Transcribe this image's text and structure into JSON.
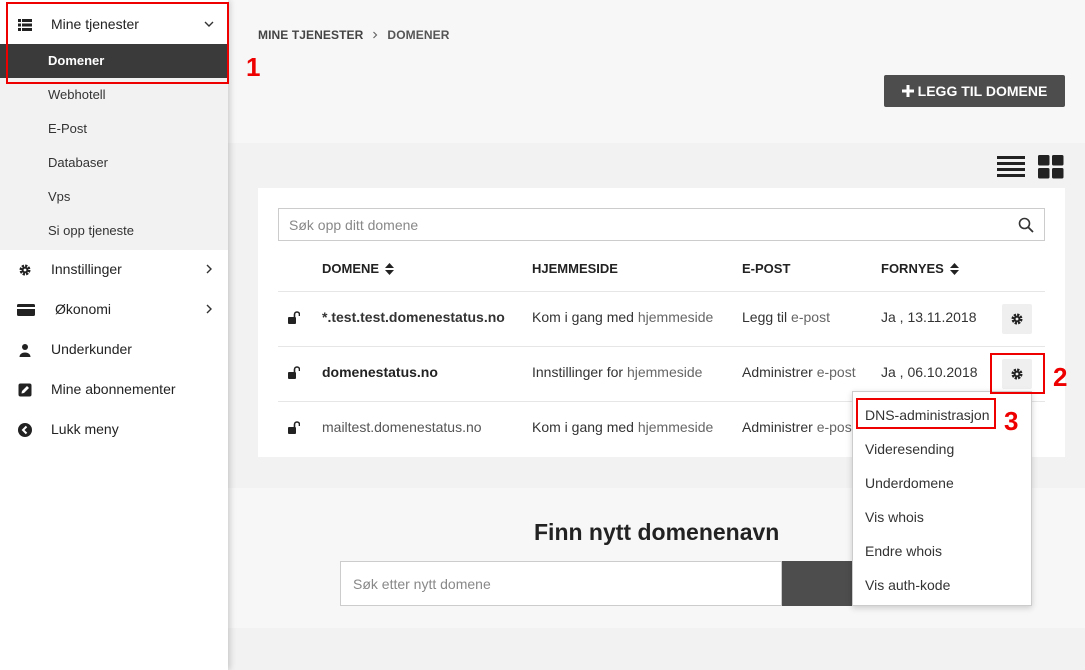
{
  "sidebar": {
    "mine_tjenester": "Mine tjenester",
    "sub_items": [
      "Domener",
      "Webhotell",
      "E-Post",
      "Databaser",
      "Vps",
      "Si opp tjeneste"
    ],
    "innstillinger": "Innstillinger",
    "okonomi": "Økonomi",
    "underkunder": "Underkunder",
    "abonnementer": "Mine abonnementer",
    "lukk": "Lukk meny"
  },
  "breadcrumb": {
    "root": "MINE TJENESTER",
    "current": "DOMENER"
  },
  "add_button": "LEGG TIL DOMENE",
  "search": {
    "placeholder": "Søk opp ditt domene"
  },
  "table": {
    "headers": {
      "domene": "DOMENE",
      "hjemmeside": "HJEMMESIDE",
      "epost": "E-POST",
      "fornyes": "FORNYES"
    },
    "rows": [
      {
        "domain": "*.test.test.domenestatus.no",
        "hs_pre": "Kom i gang med",
        "hs_link": "hjemmeside",
        "ep_pre": "Legg til",
        "ep_link": "e-post",
        "renew": "Ja , 13.11.2018"
      },
      {
        "domain": "domenestatus.no",
        "hs_pre": "Innstillinger for",
        "hs_link": "hjemmeside",
        "ep_pre": "Administrer",
        "ep_link": "e-post",
        "renew": "Ja , 06.10.2018"
      },
      {
        "domain": "mailtest.domenestatus.no",
        "hs_pre": "Kom i gang med",
        "hs_link": "hjemmeside",
        "ep_pre": "Administrer",
        "ep_link": "e-pos"
      }
    ]
  },
  "dropdown": [
    "DNS-administrasjon",
    "Videresending",
    "Underdomene",
    "Vis whois",
    "Endre whois",
    "Vis auth-kode"
  ],
  "find": {
    "title": "Finn nytt domenenavn",
    "placeholder": "Søk etter nytt domene"
  },
  "annotations": [
    "1",
    "2",
    "3"
  ],
  "colors": {
    "accent": "#e00000",
    "dark": "#3a3a3a"
  }
}
